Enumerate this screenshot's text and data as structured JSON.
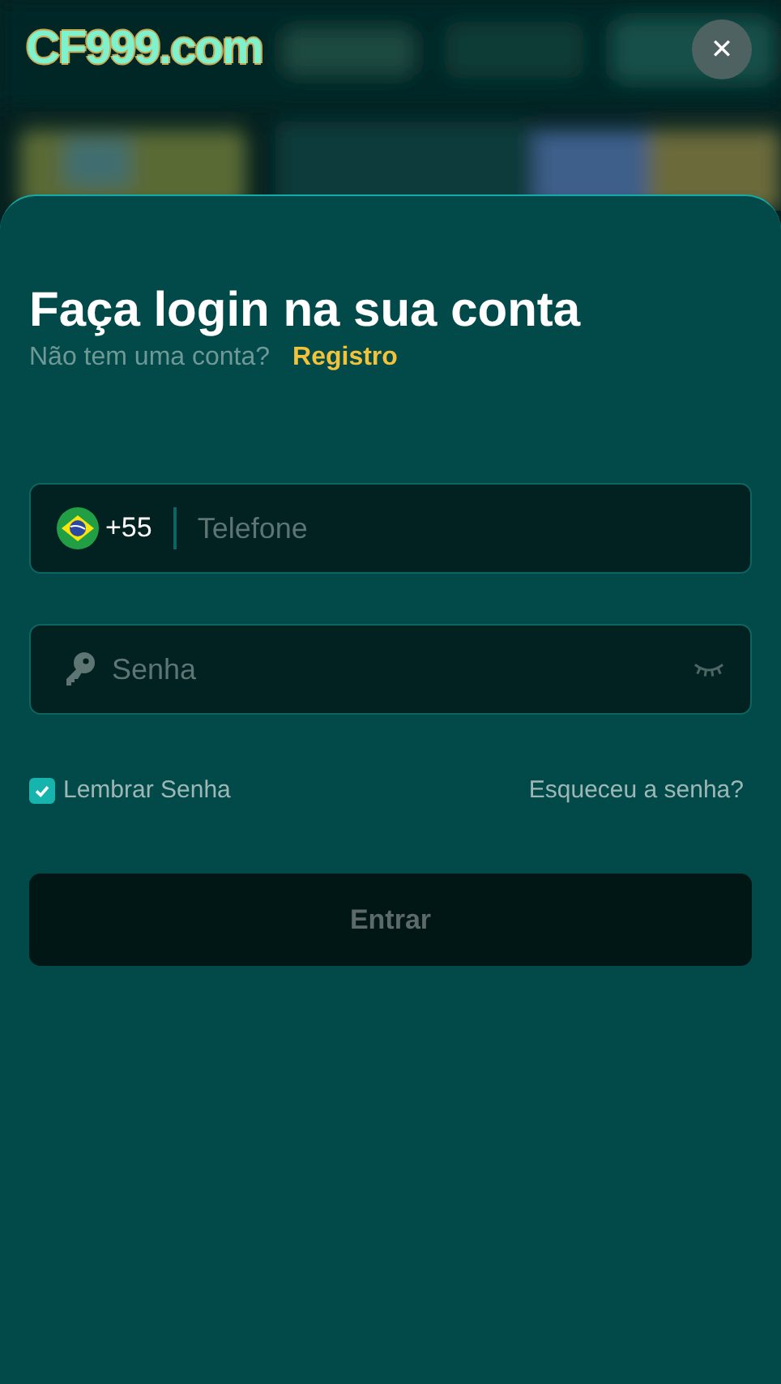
{
  "header": {
    "logo": "CF999.com",
    "close": "✕"
  },
  "login": {
    "title": "Faça login na sua conta",
    "subtitle": "Não tem uma conta?",
    "register_link": "Registro",
    "phone": {
      "country_code": "+55",
      "placeholder": "Telefone"
    },
    "password": {
      "placeholder": "Senha"
    },
    "remember": {
      "label": "Lembrar Senha",
      "checked": true
    },
    "forgot_link": "Esqueceu a senha?",
    "submit": {
      "label": "Entrar",
      "disabled": true
    }
  }
}
